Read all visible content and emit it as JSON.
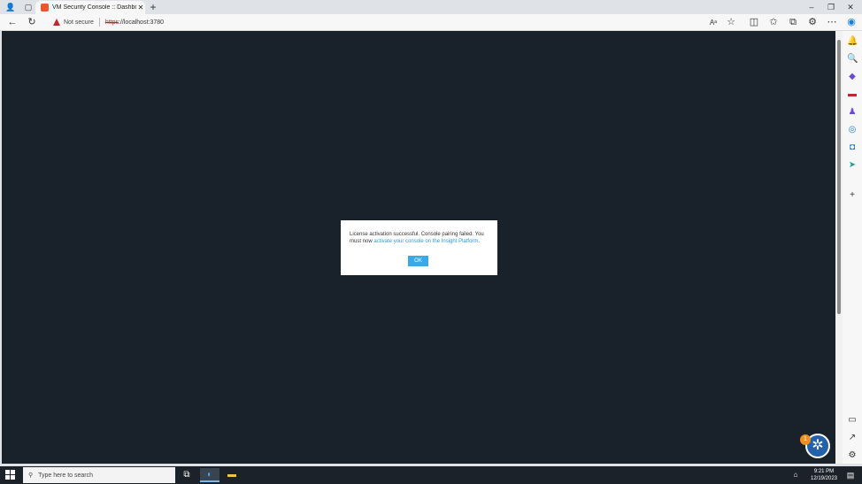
{
  "browser": {
    "tab_title": "VM Security Console :: Dashboard",
    "tab_close": "✕",
    "new_tab": "+",
    "security_label": "Not secure",
    "url_scheme": "https",
    "url_rest": "://localhost:3780",
    "window_controls": [
      "–",
      "❐",
      "✕"
    ]
  },
  "dialog": {
    "message_part1": "License activation successful. Console pairing failed. You must now ",
    "link_text": "activate your console on the Insight Platform",
    "message_end": ".",
    "ok_label": "OK"
  },
  "help": {
    "badge": "1"
  },
  "taskbar": {
    "search_placeholder": "Type here to search",
    "time": "9:21 PM",
    "date": "12/19/2023"
  },
  "colors": {
    "page_bg": "#19212b",
    "accent": "#3ba9e8",
    "link": "#2b9ad6",
    "warning": "#c4262e"
  }
}
